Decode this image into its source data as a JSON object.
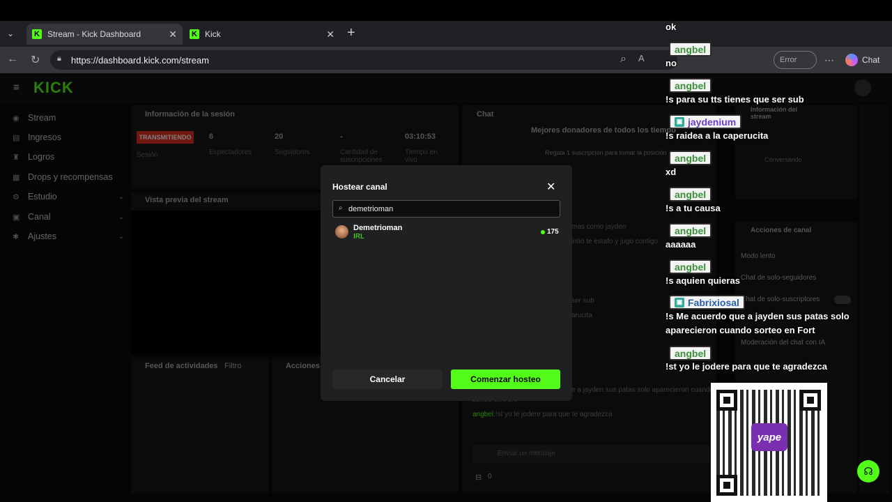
{
  "browser": {
    "tabs": [
      {
        "title": "Stream - Kick Dashboard"
      },
      {
        "title": "Kick"
      }
    ],
    "url": "https://dashboard.kick.com/stream",
    "toolbar": {
      "error_label": "Error",
      "chat_label": "Chat"
    }
  },
  "app": {
    "logo": "KICK",
    "sidebar": [
      {
        "label": "Stream"
      },
      {
        "label": "Ingresos"
      },
      {
        "label": "Logros"
      },
      {
        "label": "Drops y recompensas"
      },
      {
        "label": "Estudio"
      },
      {
        "label": "Canal"
      },
      {
        "label": "Ajustes"
      }
    ],
    "session": {
      "title": "Información de la sesión",
      "status": "TRANSMITIENDO",
      "session_label": "Sesión",
      "viewers": "6",
      "viewers_label": "Espectadores",
      "followers": "20",
      "followers_label": "Seguidores",
      "subs": "-",
      "subs_label": "Cantidad de suscripciones",
      "time": "03:10:53",
      "time_label": "Tiempo en vivo"
    },
    "preview_title": "Vista previa del stream",
    "activity": {
      "title": "Feed de actividades",
      "filter": "Filtro"
    },
    "actions_short": "Acciones d",
    "chat": {
      "title": "Chat",
      "donors_title": "Mejores donadores de todos los tiempo",
      "donors_hint": "Regala 1 suscripción para tomar la posición",
      "lines": [
        "mas como jayden",
        "intio te estafo y jugo contigo",
        "ser sub",
        "arucita",
        "e a jayden sus patas solo aparecieron cuando",
        "sorteo en Fort"
      ],
      "last_user": "angbel",
      "last_msg": ":!st yo le jodere para que te agradezca",
      "input_placeholder": "Enviar un mensaje",
      "count": "0"
    },
    "right_panels": {
      "stream_info": "Información del stream",
      "stream_sub": "Conversando",
      "channel_actions": "Acciones de canal",
      "slow_mode": "Modo lento",
      "followers_only": "Chat de solo-seguidores",
      "subs_only": "Chat de solo-suscriptores",
      "ai_mod": "Moderación del chat con IA"
    }
  },
  "modal": {
    "title": "Hostear canal",
    "search_value": "demetrioman",
    "result": {
      "name": "Demetrioman",
      "category": "IRL",
      "viewers": "175"
    },
    "cancel_label": "Cancelar",
    "start_label": "Comenzar hosteo"
  },
  "chat_overlay": [
    {
      "user": "",
      "msg": "ok"
    },
    {
      "user": "angbel",
      "msg": "no"
    },
    {
      "user": "angbel",
      "msg": "!s para su tts tienes que ser sub"
    },
    {
      "user": "jaydenium",
      "msg": "!s raidea a la caperucita",
      "sub": true
    },
    {
      "user": "angbel",
      "msg": "xd"
    },
    {
      "user": "angbel",
      "msg": "!s a tu causa"
    },
    {
      "user": "angbel",
      "msg": "aaaaaa"
    },
    {
      "user": "angbel",
      "msg": "!s aquien quieras"
    },
    {
      "user": "Fabrixiosal",
      "msg": "!s Me acuerdo que a jayden sus patas solo aparecieron cuando sorteo en Fort",
      "sub": true
    },
    {
      "user": "angbel",
      "msg": "!st yo le jodere para que te agradezca"
    }
  ],
  "qr": {
    "brand": "yape"
  },
  "colors": {
    "accent": "#53fc18",
    "live": "#e0301e"
  }
}
